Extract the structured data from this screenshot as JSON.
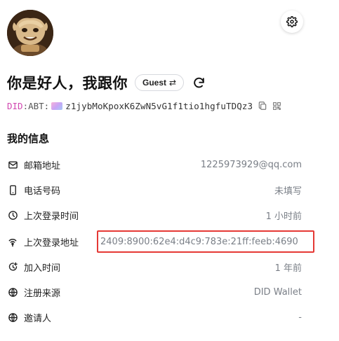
{
  "profile": {
    "name": "你是好人，我跟你",
    "role": "Guest",
    "role_switch_glyph": "⇄"
  },
  "did": {
    "prefix": "DID",
    "colon": ":",
    "abt": "ABT:",
    "address": "z1jybMoKpoxK6ZwN5vG1f1tio1hgfuTDQz3"
  },
  "section_title": "我的信息",
  "info": [
    {
      "icon": "mail-icon",
      "label": "邮箱地址",
      "value": "1225973929@qq.com"
    },
    {
      "icon": "phone-icon",
      "label": "电话号码",
      "value": "未填写"
    },
    {
      "icon": "clock-icon",
      "label": "上次登录时间",
      "value": "1 小时前"
    },
    {
      "icon": "wifi-icon",
      "label": "上次登录地址",
      "value": "2409:8900:62e4:d4c9:783e:21ff:feeb:4690"
    },
    {
      "icon": "clock-plus-icon",
      "label": "加入时间",
      "value": "1 年前"
    },
    {
      "icon": "globe-icon",
      "label": "注册来源",
      "value": "DID Wallet"
    },
    {
      "icon": "globe-icon",
      "label": "邀请人",
      "value": "-"
    }
  ],
  "colors": {
    "did_prefix": "#d147b0",
    "highlight_border": "#e53935",
    "value_text": "#7a7f87"
  }
}
